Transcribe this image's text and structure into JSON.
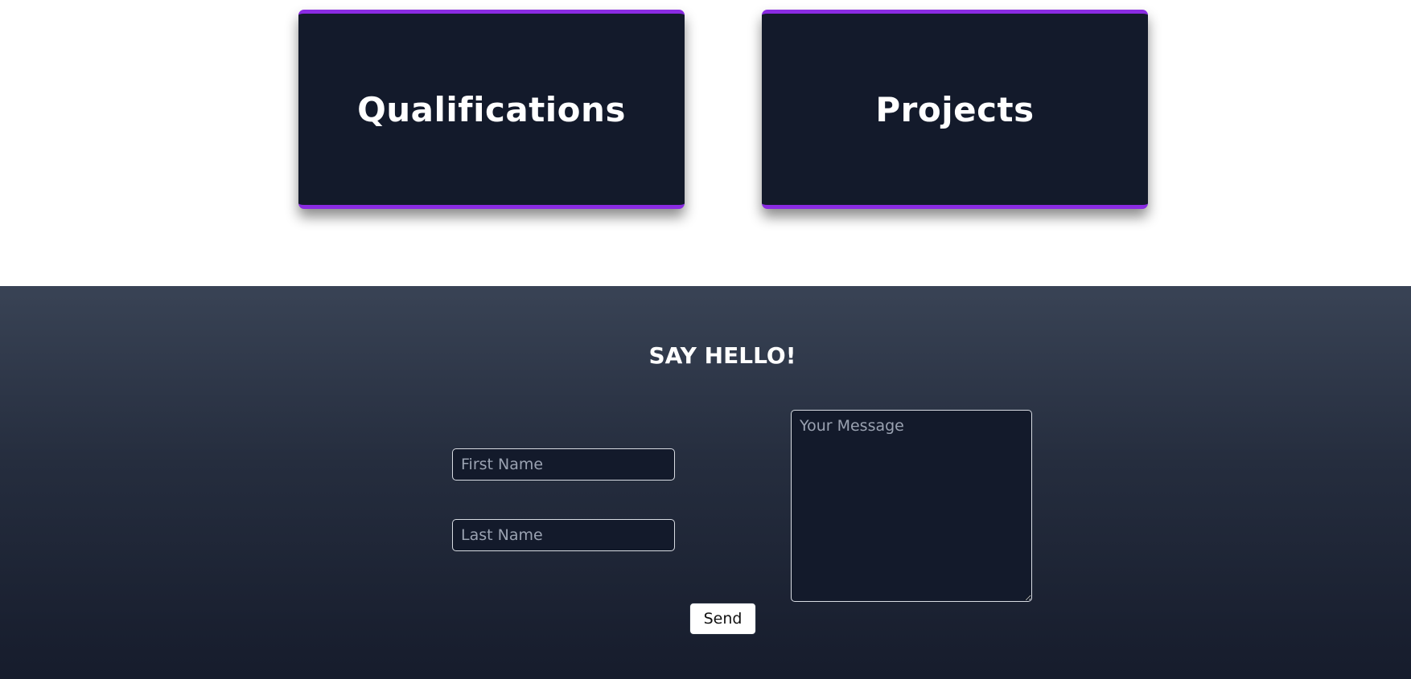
{
  "cards": {
    "qualifications_label": "Qualifications",
    "projects_label": "Projects"
  },
  "contact": {
    "heading": "SAY HELLO!",
    "first_name": {
      "value": "",
      "placeholder": "First Name"
    },
    "last_name": {
      "value": "",
      "placeholder": "Last Name"
    },
    "message": {
      "value": "",
      "placeholder": "Your Message"
    },
    "send_label": "Send"
  },
  "colors": {
    "card_background": "#131a2b",
    "card_accent": "#8a2be2",
    "section_gradient_top": "#394355",
    "section_gradient_bottom": "#161c2c"
  }
}
